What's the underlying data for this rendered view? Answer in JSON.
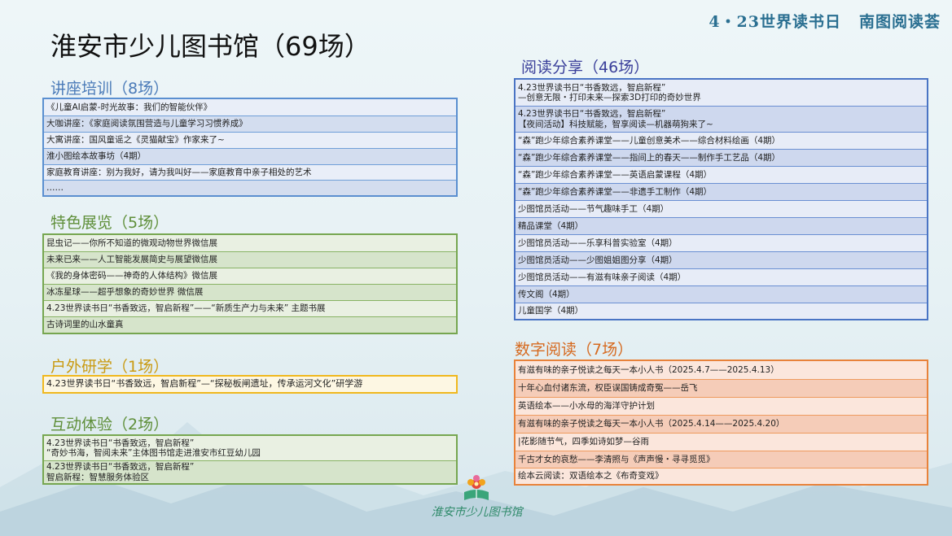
{
  "banner": {
    "left": "4・23世界读书日",
    "right": "南图阅读荟"
  },
  "title": "淮安市少儿图书馆（69场）",
  "sections": {
    "lecture": {
      "title": "讲座培训（8场）",
      "items": [
        "《儿童AI启蒙-时光故事：我们的智能伙伴》",
        "大咖讲座：《家庭阅读氛围营造与儿童学习习惯养成》",
        "大寓讲座：国风童谣之《灵猫献宝》作家来了~",
        "淮小图绘本故事坊（4期）",
        "家庭教育讲座：别为我好，请为我叫好——家庭教育中亲子相处的艺术",
        "……"
      ]
    },
    "exhibit": {
      "title": "特色展览（5场）",
      "items": [
        "昆虫记——你所不知道的微观动物世界微信展",
        "未来已来——人工智能发展简史与展望微信展",
        "《我的身体密码——神奇的人体结构》微信展",
        "冰冻星球——超乎想象的奇妙世界 微信展",
        "4.23世界读书日“书香致远，智启新程”——“新质生产力与未来” 主题书展",
        "古诗词里的山水童真"
      ]
    },
    "outdoor": {
      "title": "户外研学（1场）",
      "items": [
        "4.23世界读书日“书香致远，智启新程”—“探秘板闸遗址，传承运河文化”研学游"
      ]
    },
    "interact": {
      "title": "互动体验（2场）",
      "items": [
        [
          "4.23世界读书日“书香致远，智启新程”",
          "“奇妙书海，智阅未来”主体图书馆走进淮安市红豆幼儿园"
        ],
        [
          "4.23世界读书日“书香致远，智启新程”",
          "智启新程：智慧服务体验区"
        ]
      ]
    },
    "share": {
      "title": "阅读分享（46场）",
      "items": [
        [
          "4.23世界读书日“书香致远，智启新程”",
          "—创意无限・打印未来—探索3D打印的奇妙世界"
        ],
        [
          "4.23世界读书日“书香致远，智启新程”",
          "【夜间活动】科技赋能，智享阅读—机器萌狗来了~"
        ],
        "“森”跑少年综合素养课堂——儿童创意美术——综合材料绘画（4期）",
        "“森”跑少年综合素养课堂——指间上的春天——制作手工艺品（4期）",
        "“森”跑少年综合素养课堂——英语启蒙课程（4期）",
        "“森”跑少年综合素养课堂——非遗手工制作（4期）",
        "少图馆员活动——节气趣味手工（4期）",
        "精品课堂（4期）",
        "少图馆员活动——乐享科普实验室（4期）",
        "少图馆员活动——少图姐姐图分享（4期）",
        "少图馆员活动——有滋有味亲子阅读（4期）",
        "传文阁（4期）",
        "儿童国学（4期）"
      ]
    },
    "digital": {
      "title": "数字阅读（7场）",
      "items": [
        "有滋有味的亲子悦读之每天一本小人书（2025.4.7——2025.4.13）",
        "十年心血付诸东流，权臣误国铸成奇冤——岳飞",
        "英语绘本——小水母的海洋守护计划",
        "有滋有味的亲子悦读之每天一本小人书（2025.4.14——2025.4.20）",
        "|花影随节气，四季如诗如梦—谷雨",
        "千古才女的哀愁——李清照与《声声慢・寻寻觅觅》",
        "绘本云阅读：双语绘本之《布奇变戏》"
      ]
    }
  },
  "logo": {
    "text": "淮安市少儿图书馆",
    "icon": "book-flower-icon"
  },
  "colors": {
    "lecture": "#5a8fd0",
    "exhibit": "#76a650",
    "outdoor": "#f0b81e",
    "interact": "#76a650",
    "share": "#4a74c4",
    "digital": "#e8823a"
  }
}
